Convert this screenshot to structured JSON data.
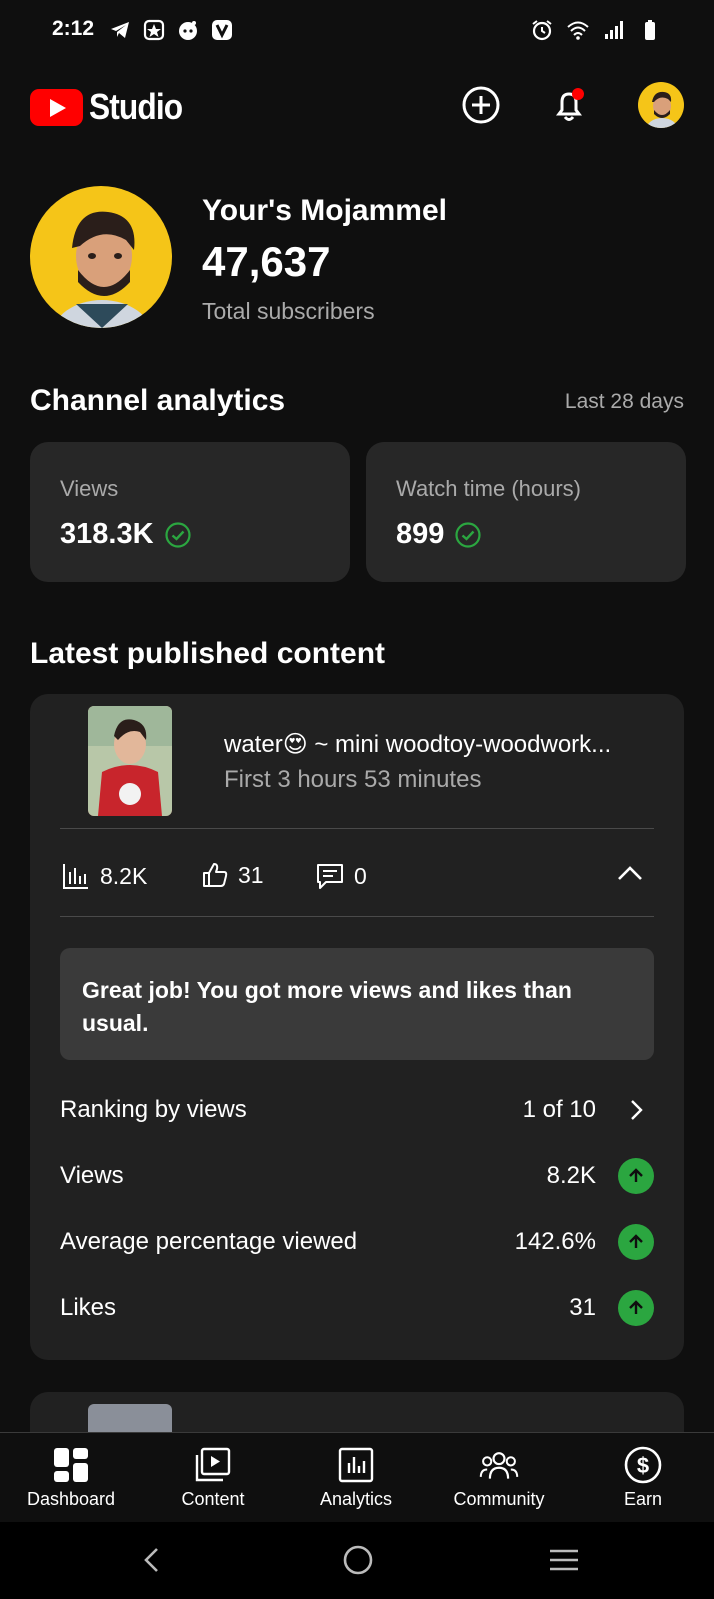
{
  "status_bar": {
    "time": "2:12",
    "left_icons": [
      "telegram-icon",
      "gallery-icon",
      "reddit-icon",
      "v-app-icon"
    ],
    "right_icons": [
      "alarm-icon",
      "wifi-icon",
      "signal-icon",
      "battery-icon"
    ]
  },
  "header": {
    "logo_text": "Studio",
    "create_icon": "add-circle-icon",
    "notification_icon": "bell-icon",
    "has_notification_dot": true
  },
  "channel": {
    "name": "Your's Mojammel",
    "subscribers": "47,637",
    "subscribers_label": "Total subscribers"
  },
  "analytics": {
    "title": "Channel analytics",
    "range": "Last 28 days",
    "cards": [
      {
        "label": "Views",
        "value": "318.3K"
      },
      {
        "label": "Watch time (hours)",
        "value": "899"
      }
    ]
  },
  "latest": {
    "title": "Latest published content",
    "video_title": "water😍 ~ mini woodtoy-woodwork...",
    "video_sub": "First 3 hours 53 minutes",
    "metrics": {
      "views": "8.2K",
      "likes": "31",
      "comments": "0"
    },
    "insight": "Great job! You got more views and likes than usual.",
    "rows": [
      {
        "label": "Ranking by views",
        "value": "1 of 10"
      },
      {
        "label": "Views",
        "value": "8.2K"
      },
      {
        "label": "Average percentage viewed",
        "value": "142.6%"
      },
      {
        "label": "Likes",
        "value": "31"
      }
    ]
  },
  "nav": {
    "items": [
      {
        "label": "Dashboard",
        "icon": "dashboard-icon"
      },
      {
        "label": "Content",
        "icon": "content-icon"
      },
      {
        "label": "Analytics",
        "icon": "analytics-icon"
      },
      {
        "label": "Community",
        "icon": "community-icon"
      },
      {
        "label": "Earn",
        "icon": "earn-icon"
      }
    ]
  },
  "colors": {
    "background": "#0f0f0f",
    "card": "#272727",
    "brand_red": "#ff0000",
    "success_green": "#2ba640"
  }
}
